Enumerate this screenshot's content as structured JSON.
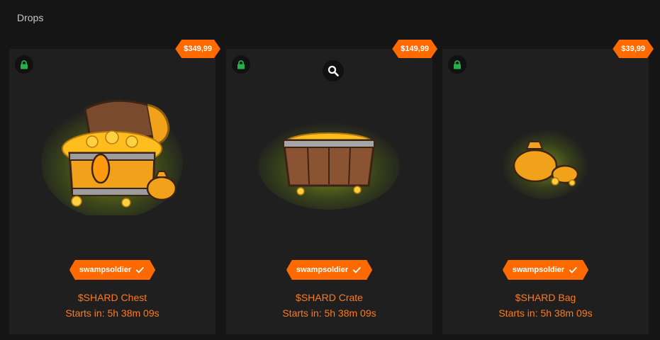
{
  "section": {
    "title": "Drops"
  },
  "accent_color": "#ff6a00",
  "lock_color": "#22b14c",
  "drops": [
    {
      "price": "$349,99",
      "owner": "swampsoldier",
      "name": "$SHARD Chest",
      "starts": "Starts in: 5h 38m 09s",
      "icon": "treasure-chest-icon",
      "locked_icon": "lock-icon"
    },
    {
      "price": "$149,99",
      "owner": "swampsoldier",
      "name": "$SHARD Crate",
      "starts": "Starts in: 5h 38m 09s",
      "icon": "crate-icon",
      "locked_icon": "lock-icon",
      "action_icon": "search-icon"
    },
    {
      "price": "$39,99",
      "owner": "swampsoldier",
      "name": "$SHARD Bag",
      "starts": "Starts in: 5h 38m 09s",
      "icon": "coin-bag-icon",
      "locked_icon": "lock-icon"
    }
  ]
}
